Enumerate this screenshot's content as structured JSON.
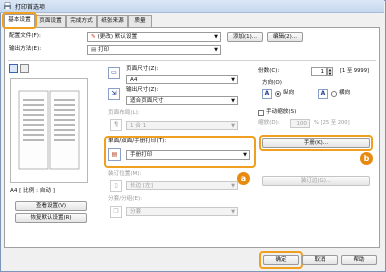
{
  "window": {
    "title": "打印首选项"
  },
  "tabs": [
    {
      "label": "基本设置",
      "active": true
    },
    {
      "label": "页面设置"
    },
    {
      "label": "完成方式"
    },
    {
      "label": "纸张来源"
    },
    {
      "label": "质量"
    }
  ],
  "profile": {
    "label": "配置文件(F):",
    "value": "(更改) 默认设置",
    "add_button": "添加(1)...",
    "edit_button": "编辑(2)..."
  },
  "output": {
    "label": "输出方法(E):",
    "value": "打印"
  },
  "preview": {
    "caption": "A4 [ 比例 : 自动 ]",
    "view_settings_button": "查看设置(V)",
    "restore_defaults_button": "恢复默认设置(R)"
  },
  "page_size": {
    "label": "页面尺寸(Z):",
    "value": "A4"
  },
  "output_size": {
    "label": "输出尺寸(Z):",
    "value": "适合页面尺寸"
  },
  "layout": {
    "label": "页面布局(L):",
    "value": "1 合 1"
  },
  "copies": {
    "label": "份数(C):",
    "value": "1",
    "range": "[1 至 9999]"
  },
  "orientation": {
    "label": "方向(O)",
    "portrait": "纵向",
    "landscape": "横向",
    "selected": "portrait"
  },
  "manual_scaling": {
    "label": "手动缩放(S)",
    "scale_label": "缩放(D):",
    "scale_value": "100",
    "scale_range": "% [25 至 200]"
  },
  "duplex": {
    "label": "单面/双面/手册打印(T):",
    "value": "手册打印",
    "booklet_button": "手册(K)...",
    "binding_label": "装订位置(M):",
    "binding_value": "长边 [左]",
    "gutter_button": "装订边(G)..."
  },
  "collate": {
    "label": "分套/分组(E):",
    "value": "分套"
  },
  "markers": {
    "a": "a",
    "b": "b"
  },
  "footer": {
    "ok": "确定",
    "cancel": "取消",
    "help": "帮助"
  }
}
